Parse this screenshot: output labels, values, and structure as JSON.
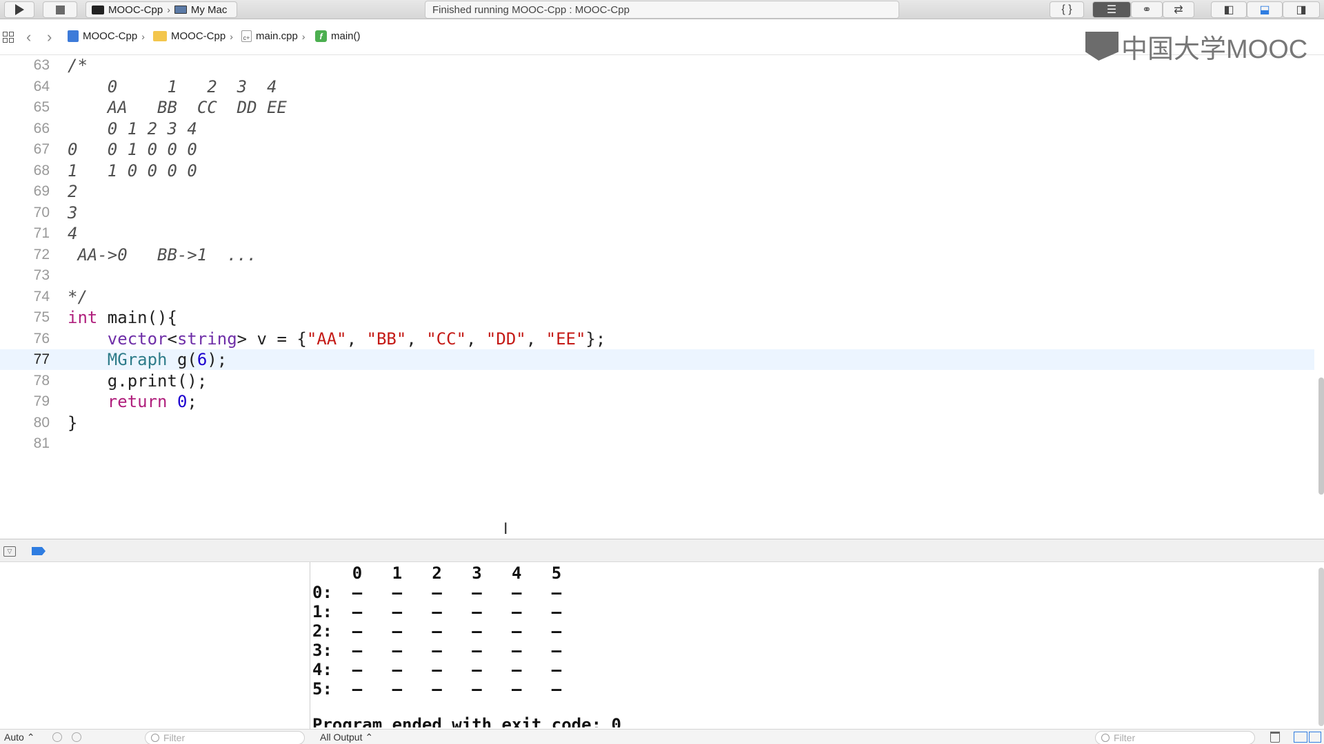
{
  "toolbar": {
    "scheme_name": "MOOC-Cpp",
    "destination": "My Mac",
    "status": "Finished running MOOC-Cpp : MOOC-Cpp",
    "braces_label": "{ }"
  },
  "jumpbar": {
    "crumbs": [
      "MOOC-Cpp",
      "MOOC-Cpp",
      "main.cpp",
      "main()"
    ]
  },
  "watermark": {
    "text": "中国大学MOOC"
  },
  "editor": {
    "highlighted_line": 77,
    "lines": [
      {
        "num": "63"
      },
      {
        "num": "64"
      },
      {
        "num": "65"
      },
      {
        "num": "66"
      },
      {
        "num": "67"
      },
      {
        "num": "68"
      },
      {
        "num": "69"
      },
      {
        "num": "70"
      },
      {
        "num": "71"
      },
      {
        "num": "72"
      },
      {
        "num": "73"
      },
      {
        "num": "74"
      },
      {
        "num": "75"
      },
      {
        "num": "76"
      },
      {
        "num": "77"
      },
      {
        "num": "78"
      },
      {
        "num": "79"
      },
      {
        "num": "80"
      },
      {
        "num": "81"
      }
    ],
    "code": {
      "l63": "/*",
      "l64": "    0     1   2  3  4",
      "l65": "    AA   BB  CC  DD EE",
      "l66": "    0 1 2 3 4",
      "l67": "0   0 1 0 0 0",
      "l68": "1   1 0 0 0 0",
      "l69": "2",
      "l70": "3",
      "l71": "4",
      "l72": " AA->0   BB->1  ...",
      "l74": "*/",
      "l75_kw": "int",
      "l75_rest": " main(){",
      "l76_indent": "    ",
      "l76_type": "vector",
      "l76_lt": "<",
      "l76_str_type": "string",
      "l76_mid": "> v = {",
      "l76_s1": "\"AA\"",
      "l76_s2": "\"BB\"",
      "l76_s3": "\"CC\"",
      "l76_s4": "\"DD\"",
      "l76_s5": "\"EE\"",
      "l76_comma": ", ",
      "l76_end": "};",
      "l77_indent": "    ",
      "l77_type": "MGraph",
      "l77_call": " g(",
      "l77_num": "6",
      "l77_end": ");",
      "l78": "    g.print();",
      "l79_indent": "    ",
      "l79_kw": "return",
      "l79_sp": " ",
      "l79_num": "0",
      "l79_end": ";",
      "l80": "}"
    }
  },
  "console": {
    "header": "    0   1   2   3   4   5",
    "rows": [
      "0:  –   –   –   –   –   –",
      "1:  –   –   –   –   –   –",
      "2:  –   –   –   –   –   –",
      "3:  –   –   –   –   –   –",
      "4:  –   –   –   –   –   –",
      "5:  –   –   –   –   –   –"
    ],
    "exit_message": "Program ended with exit code: 0"
  },
  "bottombar": {
    "auto_label": "Auto ⌃",
    "filter_placeholder": "Filter",
    "output_selector": "All Output ⌃",
    "filter_placeholder_right": "Filter"
  }
}
